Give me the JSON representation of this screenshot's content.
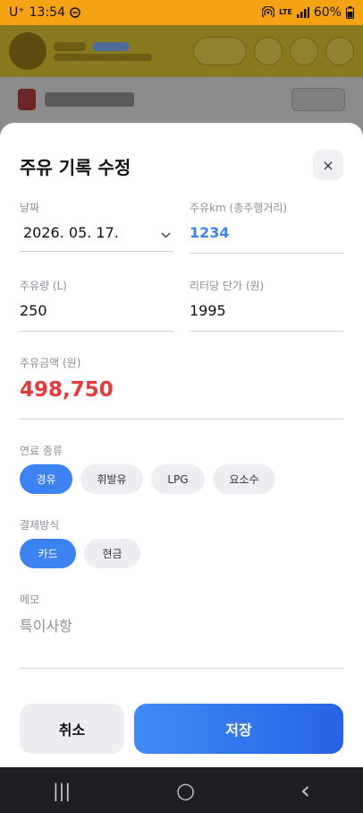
{
  "status": {
    "carrier": "U⁺",
    "time": "13:54",
    "network": "LTE",
    "battery": "60%"
  },
  "sheet": {
    "title": "주유 기록 수정",
    "close_icon": "×"
  },
  "fields": {
    "date": {
      "label": "날짜",
      "value": "2026. 05. 17."
    },
    "odometer": {
      "label": "주유km (총주행거리)",
      "value": "1234"
    },
    "amount_l": {
      "label": "주유량 (L)",
      "value": "250"
    },
    "price_per_l": {
      "label": "리터당 단가 (원)",
      "value": "1995"
    },
    "total": {
      "label": "주유금액 (원)",
      "value": "498,750"
    },
    "memo": {
      "label": "메모",
      "placeholder": "특이사항"
    }
  },
  "fuel": {
    "label": "연료 종류",
    "options": [
      "경유",
      "휘발유",
      "LPG",
      "요소수"
    ],
    "selected": "경유"
  },
  "payment": {
    "label": "결제방식",
    "options": [
      "카드",
      "현금"
    ],
    "selected": "카드"
  },
  "buttons": {
    "cancel": "취소",
    "save": "저장"
  },
  "colors": {
    "accent": "#3d82f2",
    "total": "#e5393c",
    "odometer": "#3d82f2",
    "status_bar": "#f5a312"
  },
  "nav": {
    "recents_icon": "|||",
    "home_icon": "○",
    "back_icon": "‹"
  }
}
